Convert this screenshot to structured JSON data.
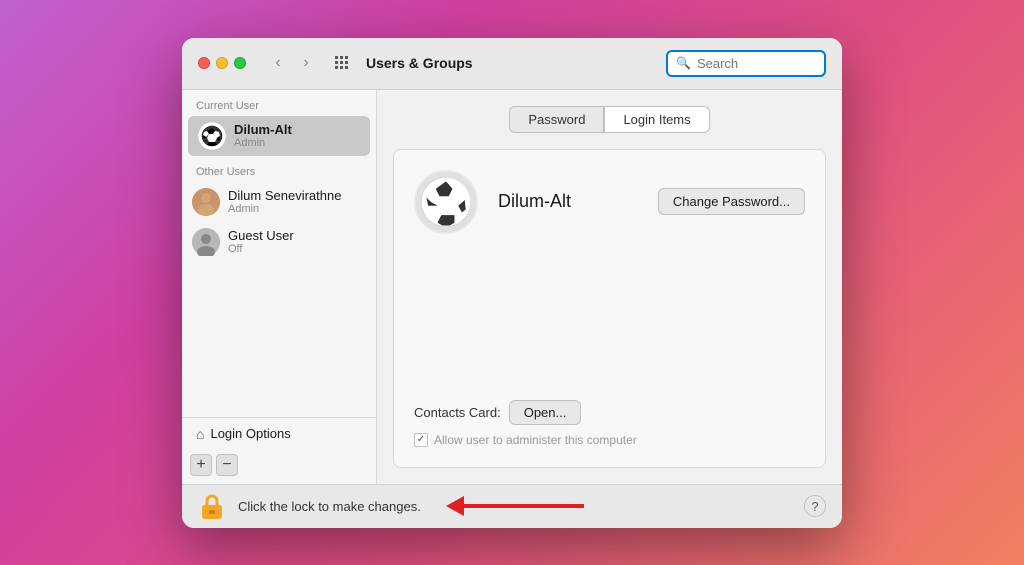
{
  "window": {
    "title": "Users & Groups",
    "search_placeholder": "Search"
  },
  "sidebar": {
    "current_user_label": "Current User",
    "other_users_label": "Other Users",
    "current_user": {
      "name": "Dilum-Alt",
      "role": "Admin"
    },
    "other_users": [
      {
        "name": "Dilum Senevirathne",
        "role": "Admin"
      },
      {
        "name": "Guest User",
        "role": "Off"
      }
    ],
    "login_options_label": "Login Options",
    "add_button": "+",
    "remove_button": "−"
  },
  "tabs": {
    "password_label": "Password",
    "login_items_label": "Login Items"
  },
  "main_panel": {
    "username": "Dilum-Alt",
    "change_password_btn": "Change Password...",
    "contacts_label": "Contacts Card:",
    "open_btn": "Open...",
    "admin_checkbox_label": "Allow user to administer this computer",
    "admin_checked": true
  },
  "bottom_bar": {
    "lock_text": "Click the lock to make changes.",
    "help_label": "?"
  }
}
